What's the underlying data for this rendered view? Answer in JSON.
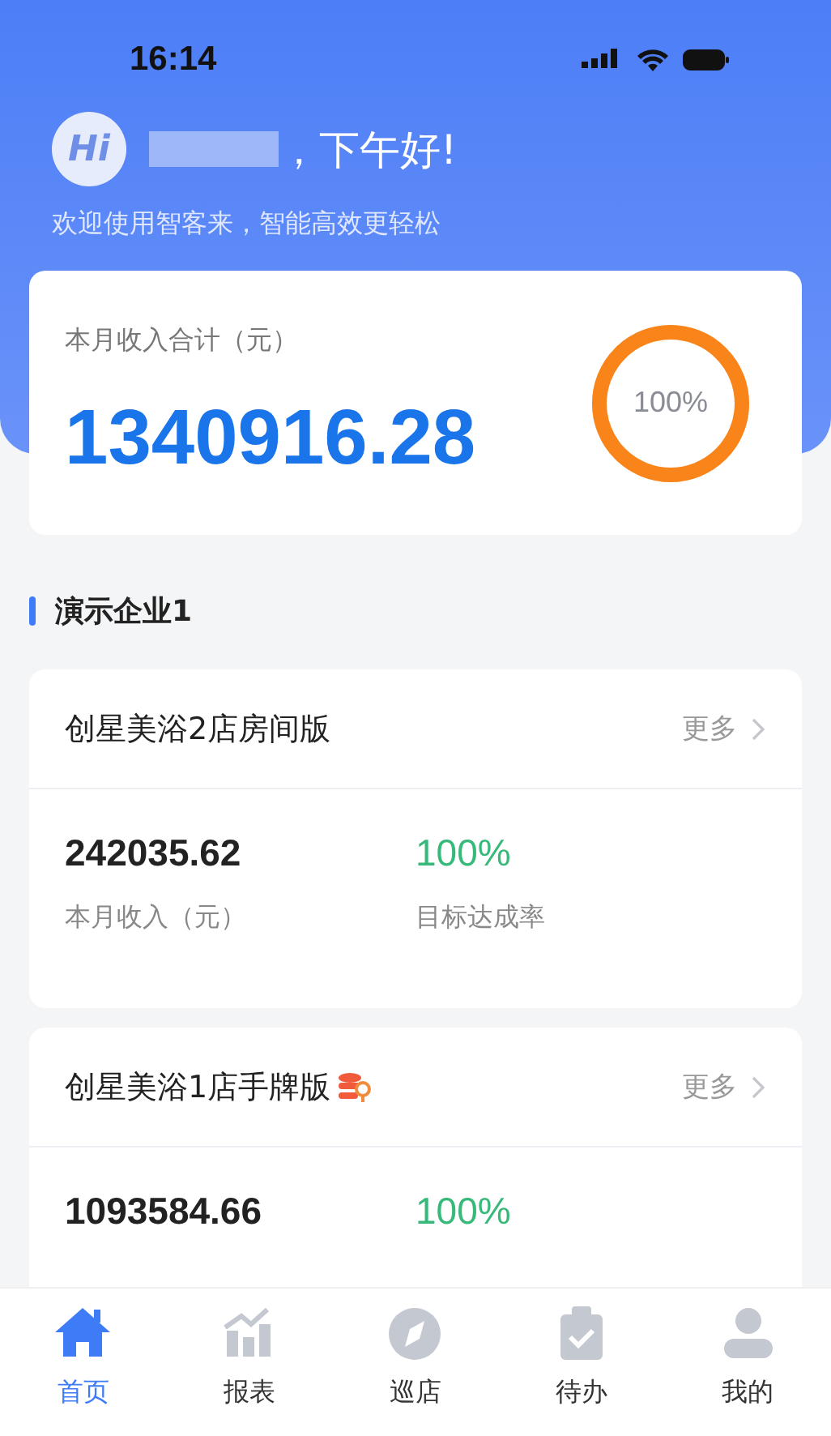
{
  "status_bar": {
    "time": "16:14"
  },
  "greeting": {
    "avatar": "Hi",
    "name_redacted": true,
    "text": "，下午好!",
    "subtitle": "欢迎使用智客来，智能高效更轻松"
  },
  "summary": {
    "label": "本月收入合计（元）",
    "amount": "1340916.28",
    "ring": {
      "level": 1,
      "reading": "100%"
    }
  },
  "section": {
    "title": "演示企业1"
  },
  "stores": [
    {
      "name": "创星美浴2店房间版",
      "has_badge": false,
      "more": "更多",
      "income": "242035.62",
      "income_label": "本月收入（元）",
      "rate": "100%",
      "rate_label": "目标达成率"
    },
    {
      "name": "创星美浴1店手牌版",
      "has_badge": true,
      "more": "更多",
      "income": "1093584.66",
      "rate": "100%"
    }
  ],
  "tabs": [
    {
      "kind": "home",
      "label": "首页",
      "selected": true
    },
    {
      "kind": "report",
      "label": "报表",
      "selected": false
    },
    {
      "kind": "patrol",
      "label": "巡店",
      "selected": false
    },
    {
      "kind": "todo",
      "label": "待办",
      "selected": false
    },
    {
      "kind": "mine",
      "label": "我的",
      "selected": false
    }
  ]
}
